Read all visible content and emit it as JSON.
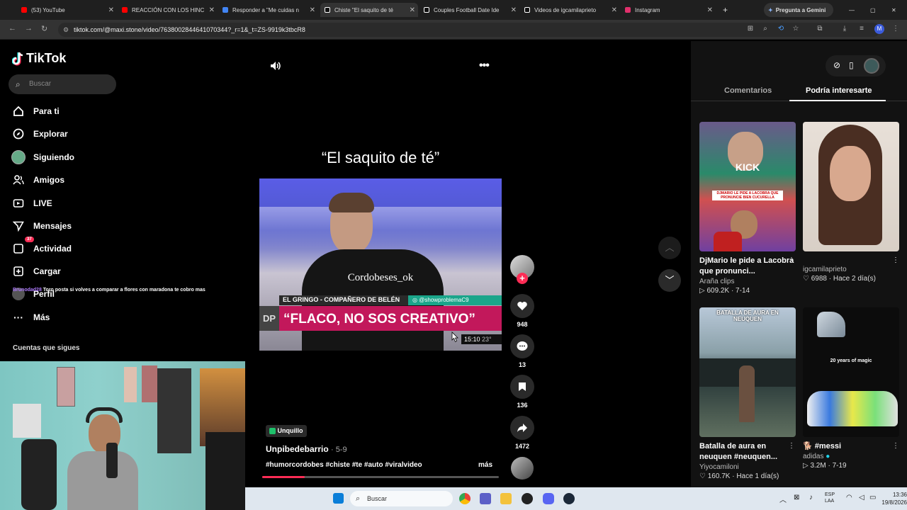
{
  "browser": {
    "tabs": [
      {
        "title": "(53) YouTube",
        "color": "#ff0000"
      },
      {
        "title": "REACCIÓN CON LOS HINC",
        "color": "#ff0000"
      },
      {
        "title": "Responder a \"Me cuidas n",
        "color": "#4285f4"
      },
      {
        "title": "Chiste \"El saquito de té",
        "color": "#ffffff"
      },
      {
        "title": "Couples Football Date Ide",
        "color": "#ffffff"
      },
      {
        "title": "Videos de igcamilaprieto",
        "color": "#ffffff"
      },
      {
        "title": "Instagram",
        "color": "#e1306c"
      }
    ],
    "gemini_button": "Pregunta a Gemini",
    "url": "tiktok.com/@maxi.stone/video/7638002844641070344?_r=1&_t=ZS-9919k3tbcR8"
  },
  "sidebar": {
    "logo": "TikTok",
    "search_placeholder": "Buscar",
    "items": [
      {
        "label": "Para ti",
        "icon": "home-icon"
      },
      {
        "label": "Explorar",
        "icon": "compass-icon"
      },
      {
        "label": "Siguiendo",
        "icon": "avatar-icon"
      },
      {
        "label": "Amigos",
        "icon": "friends-icon"
      },
      {
        "label": "LIVE",
        "icon": "live-icon"
      },
      {
        "label": "Mensajes",
        "icon": "message-icon"
      },
      {
        "label": "Actividad",
        "icon": "activity-icon",
        "badge": "37"
      },
      {
        "label": "Cargar",
        "icon": "upload-icon"
      },
      {
        "label": "Perfil",
        "icon": "profile-icon"
      },
      {
        "label": "Más",
        "icon": "more-icon"
      }
    ],
    "overlay_user": "Brunodad28",
    "overlay_comment": "Toro posta si volves a comparar a flores con maradona te cobro mas",
    "following_title": "Cuentas que sigues"
  },
  "video": {
    "title": "“El saquito de té”",
    "watermark": "Cordobeses_ok",
    "lower_third_name": "EL GRINGO - COMPAÑERO DE BELÉN",
    "lower_third_handle": "@showproblemaC9",
    "headline": "“FLACO, NO SOS CREATIVO”",
    "logo_text": "DP",
    "clock": "15:10",
    "clock2": "23°",
    "location": "Unquillo",
    "author": "Unpibedebarrio",
    "date": "· 5-9",
    "hashtags": "#humorcordobes #chiste #te #auto #viralvideo",
    "more": "más",
    "likes": "948",
    "comments": "13",
    "saves": "136",
    "shares": "1472"
  },
  "right_panel": {
    "tabs": [
      "Comentarios",
      "Podría interesarte"
    ],
    "cards": [
      {
        "title": "DjMario le pide a Lacobra que pronunci...",
        "author": "Araña clips",
        "meta": "▷ 609.2K · 7-14",
        "thumb_text": "KICK"
      },
      {
        "title": "",
        "author": "igcamilaprieto",
        "meta": "♡ 6988 · Hace 2 día(s)",
        "thumb_text": ""
      },
      {
        "title": "Batalla de aura en neuquen #neuquen...",
        "author": "Yiyocamiloni",
        "meta": "♡ 160.7K · Hace 1 día(s)",
        "thumb_text": "BATALLA DE AURA EN NEUQUEN"
      },
      {
        "title": "🐕 #messi",
        "author": "adidas",
        "meta": "▷ 3.2M · 7-19",
        "thumb_text": "20 years of magic"
      }
    ],
    "thumb_caption": "DJMARIO LE PIDE A LACOBRA QUE PRONUNCIE BIEN CUCURELLA"
  },
  "taskbar": {
    "search": "Buscar",
    "lang": "ESP\nLAA",
    "time": "13:36",
    "date": "19/8/2026"
  },
  "colors": {
    "accent": "#fe2c55",
    "bg": "#000000",
    "panel": "#121212"
  }
}
